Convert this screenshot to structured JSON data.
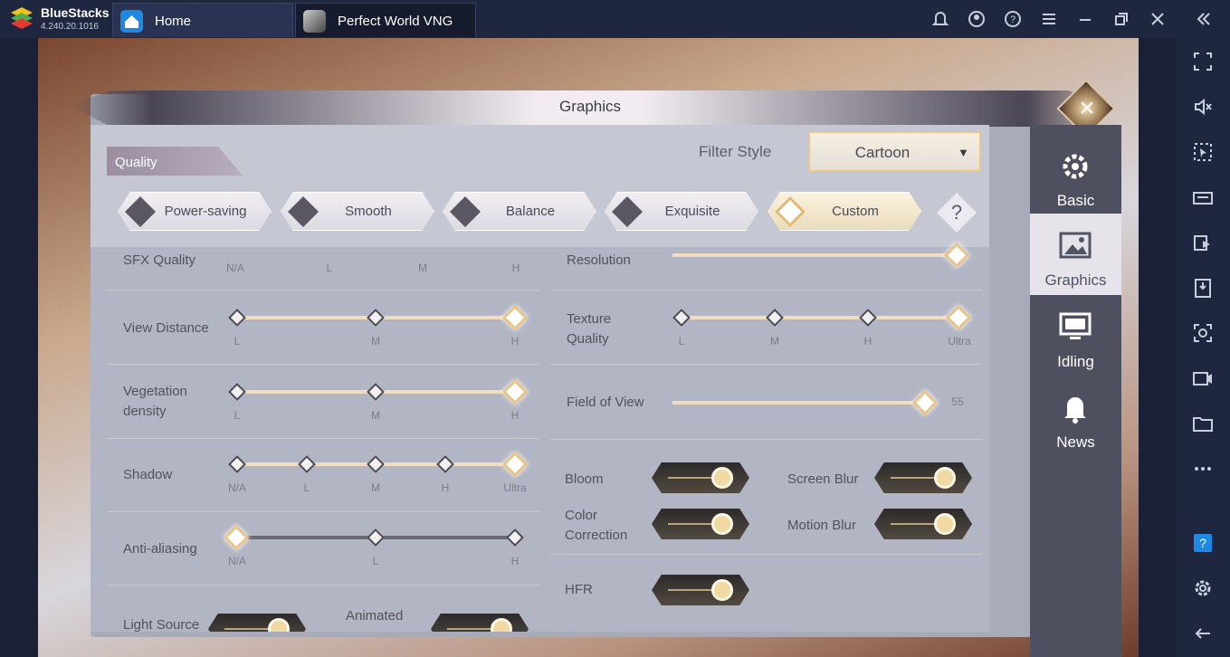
{
  "titlebar": {
    "brand": "BlueStacks",
    "version": "4.240.20.1016",
    "tabs": [
      {
        "label": "Home",
        "icon": "home-icon"
      },
      {
        "label": "Perfect World VNG",
        "icon": "game-icon"
      }
    ],
    "icons": [
      "bell-icon",
      "account-icon",
      "help-icon",
      "menu-icon",
      "minimize-icon",
      "restore-icon",
      "close-icon",
      "collapse-icon"
    ]
  },
  "sidebar": {
    "icons": [
      "fullscreen-icon",
      "volume-mute-icon",
      "pointer-icon",
      "keyboard-icon",
      "multi-instance-icon",
      "apk-install-icon",
      "screenshot-icon",
      "record-icon",
      "folder-icon",
      "more-icon",
      "help-icon",
      "settings-icon",
      "back-icon"
    ]
  },
  "panel": {
    "title": "Graphics",
    "quality_tab": "Quality",
    "filter_label": "Filter Style",
    "filter_value": "Cartoon",
    "presets": [
      {
        "label": "Power-saving",
        "selected": false
      },
      {
        "label": "Smooth",
        "selected": false
      },
      {
        "label": "Balance",
        "selected": false
      },
      {
        "label": "Exquisite",
        "selected": false
      },
      {
        "label": "Custom",
        "selected": true
      }
    ],
    "help": "?",
    "left": {
      "sfx": {
        "label": "SFX Quality",
        "ticks": [
          "N/A",
          "L",
          "M",
          "H"
        ]
      },
      "view_distance": {
        "label": "View Distance",
        "ticks": [
          "L",
          "M",
          "H"
        ],
        "value": "H"
      },
      "vegetation": {
        "label": "Vegetation density",
        "ticks": [
          "L",
          "M",
          "H"
        ],
        "value": "H"
      },
      "shadow": {
        "label": "Shadow",
        "ticks": [
          "N/A",
          "L",
          "M",
          "H",
          "Ultra"
        ],
        "value": "Ultra"
      },
      "anti_aliasing": {
        "label": "Anti-aliasing",
        "ticks": [
          "N/A",
          "L",
          "H"
        ],
        "value": "N/A"
      },
      "light_source": {
        "label": "Light Source"
      },
      "animated": {
        "label": "Animated"
      }
    },
    "right": {
      "resolution": {
        "label": "Resolution",
        "value": 1.0
      },
      "texture": {
        "label": "Texture Quality",
        "ticks": [
          "L",
          "M",
          "H",
          "Ultra"
        ],
        "value": "Ultra"
      },
      "fov": {
        "label": "Field of View",
        "value": "55"
      },
      "bloom": {
        "label": "Bloom",
        "on": true
      },
      "screen_blur": {
        "label": "Screen Blur",
        "on": true
      },
      "color_correction": {
        "label": "Color Correction",
        "on": true
      },
      "motion_blur": {
        "label": "Motion Blur",
        "on": true
      },
      "hfr": {
        "label": "HFR",
        "on": true
      }
    },
    "tabs": [
      {
        "label": "Basic",
        "icon": "gear-icon",
        "selected": false
      },
      {
        "label": "Graphics",
        "icon": "image-icon",
        "selected": true
      },
      {
        "label": "Idling",
        "icon": "monitor-icon",
        "selected": false
      },
      {
        "label": "News",
        "icon": "bell-icon",
        "selected": false
      }
    ]
  }
}
